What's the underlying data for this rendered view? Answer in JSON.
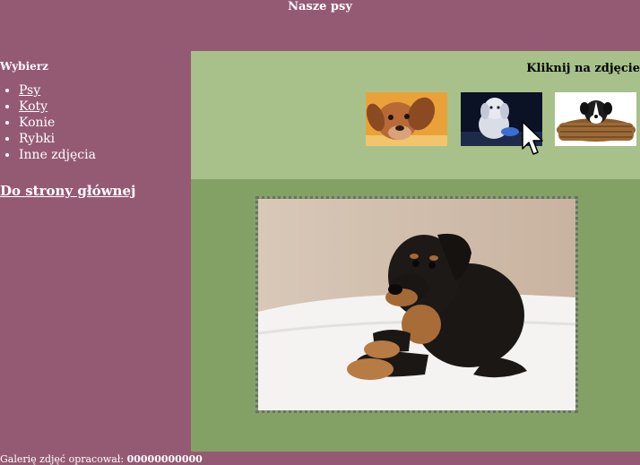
{
  "header": {
    "title": "Nasze psy"
  },
  "sidebar": {
    "title": "Wybierz",
    "items": [
      {
        "label": "Psy",
        "link": true
      },
      {
        "label": "Koty",
        "link": true
      },
      {
        "label": "Konie",
        "link": false
      },
      {
        "label": "Rybki",
        "link": false
      },
      {
        "label": "Inne zdjęcia",
        "link": false
      }
    ],
    "home_link": "Do strony głównej"
  },
  "gallery": {
    "hint": "Kliknij na zdjęcie",
    "thumbnails": [
      {
        "subject": "brown-puppy-lying"
      },
      {
        "subject": "white-puppy-blue-toy"
      },
      {
        "subject": "puppy-in-basket"
      }
    ]
  },
  "main_photo": {
    "subject": "rottweiler-puppy-on-white-blanket"
  },
  "footer": {
    "author_label": "Galerię zdjęć opracował:",
    "author_id": "00000000000"
  },
  "colors": {
    "page_bg": "#955a73",
    "thumbs_panel_bg": "#a8c18a",
    "main_panel_bg": "#83a165"
  }
}
